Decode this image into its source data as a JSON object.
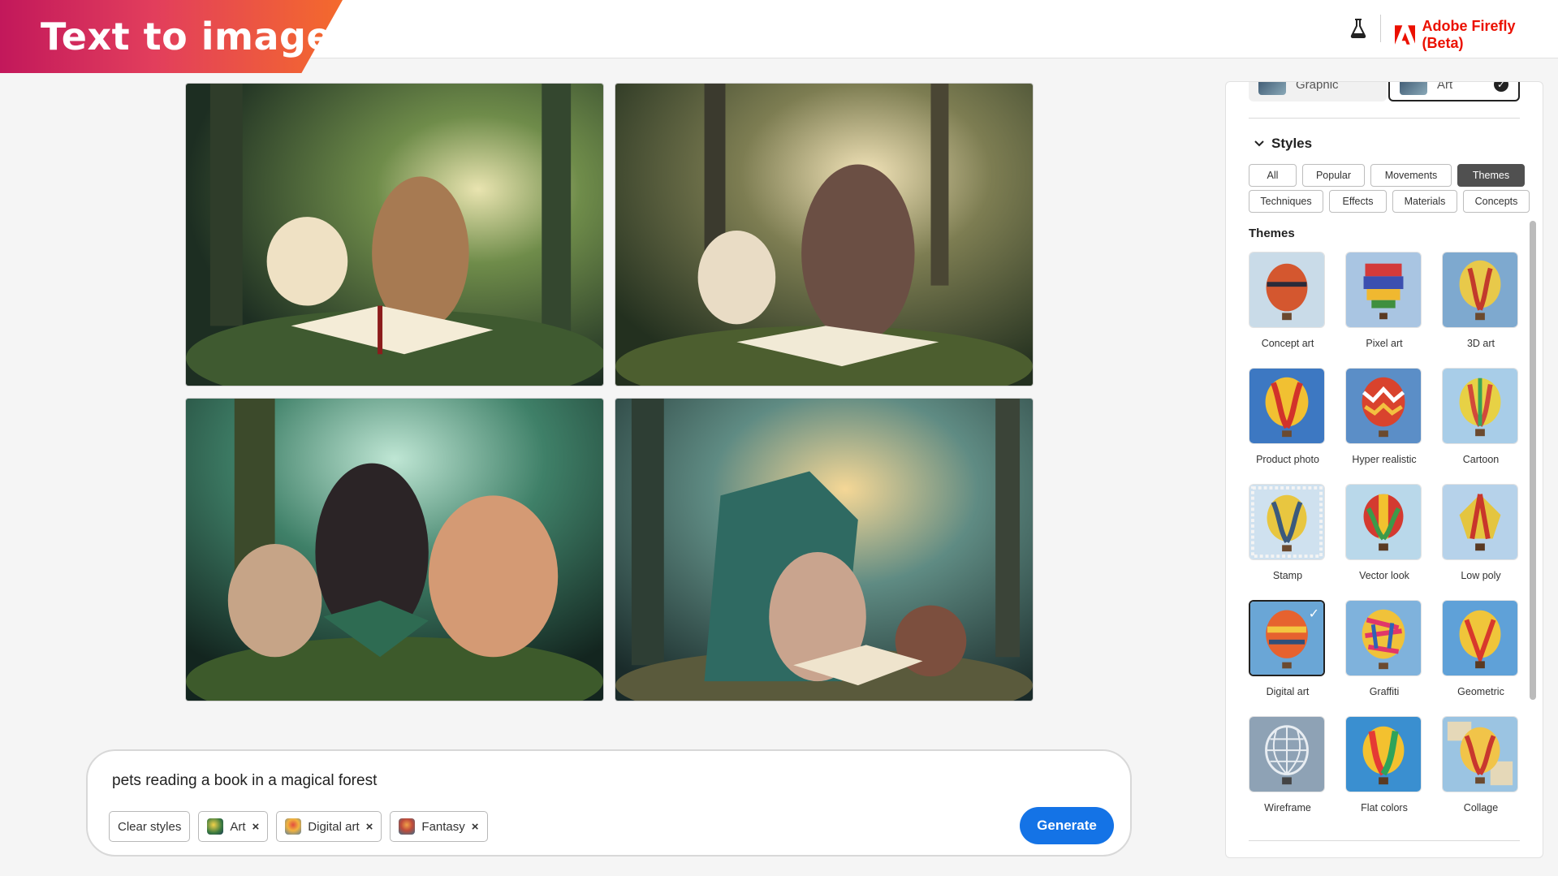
{
  "header": {
    "page_title": "Text to image",
    "brand_name": "Adobe Firefly (Beta)",
    "brand_color": "#eb1000",
    "lab_icon": "beaker-icon"
  },
  "results": [
    {
      "label": "pets reading a book in a magical forest — result 1"
    },
    {
      "label": "pets reading a book in a magical forest — result 2"
    },
    {
      "label": "pets reading a book in a magical forest — result 3"
    },
    {
      "label": "pets reading a book in a magical forest — result 4"
    }
  ],
  "prompt": {
    "text": "pets reading a book in a magical forest",
    "clear_label": "Clear styles",
    "chips": [
      {
        "label": "Art",
        "close": "×"
      },
      {
        "label": "Digital art",
        "close": "×"
      },
      {
        "label": "Fantasy",
        "close": "×"
      }
    ],
    "generate_label": "Generate",
    "generate_color": "#1473e6"
  },
  "panel": {
    "content_types": [
      {
        "label": "Graphic",
        "selected": false
      },
      {
        "label": "Art",
        "selected": true
      }
    ],
    "styles_heading": "Styles",
    "tabs_row1": [
      "All",
      "Popular",
      "Movements",
      "Themes"
    ],
    "tabs_row2": [
      "Techniques",
      "Effects",
      "Materials",
      "Concepts"
    ],
    "active_tab": "Themes",
    "themes_heading": "Themes",
    "themes": [
      {
        "label": "Concept art"
      },
      {
        "label": "Pixel art"
      },
      {
        "label": "3D art"
      },
      {
        "label": "Product photo"
      },
      {
        "label": "Hyper realistic"
      },
      {
        "label": "Cartoon"
      },
      {
        "label": "Stamp"
      },
      {
        "label": "Vector look"
      },
      {
        "label": "Low poly"
      },
      {
        "label": "Digital art",
        "selected": true
      },
      {
        "label": "Graffiti"
      },
      {
        "label": "Geometric"
      },
      {
        "label": "Wireframe"
      },
      {
        "label": "Flat colors"
      },
      {
        "label": "Collage"
      }
    ]
  }
}
